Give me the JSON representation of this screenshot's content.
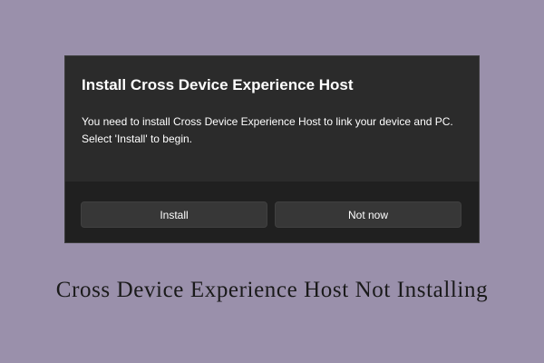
{
  "dialog": {
    "title": "Install Cross Device Experience Host",
    "message_line1": "You need to install Cross Device Experience Host to link your device and PC.",
    "message_line2": "Select 'Install' to begin.",
    "install_label": "Install",
    "not_now_label": "Not now"
  },
  "caption": "Cross Device Experience Host Not Installing",
  "colors": {
    "background": "#9a90ab",
    "dialog": "#2b2b2b",
    "footer": "#202020",
    "button": "#373737"
  }
}
